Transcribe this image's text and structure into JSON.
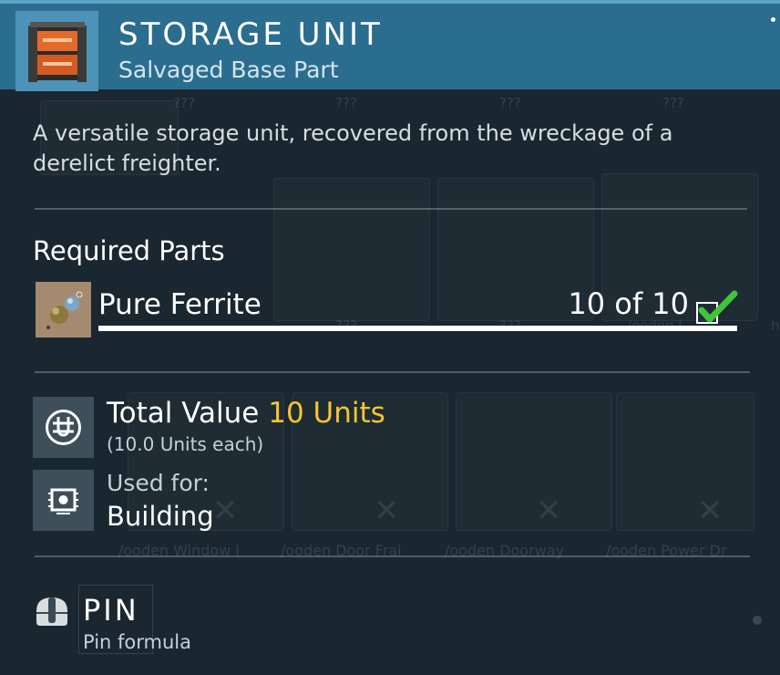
{
  "item": {
    "title": "STORAGE UNIT",
    "subtitle": "Salvaged Base Part",
    "icon": "storage-crate-icon",
    "description": "A versatile storage unit, recovered from the wreckage of a derelict freighter."
  },
  "required_parts": {
    "heading": "Required Parts",
    "items": [
      {
        "name": "Pure Ferrite",
        "count": "10 of 10",
        "icon": "pure-ferrite-icon",
        "complete": true,
        "progress": 1.0
      }
    ]
  },
  "value": {
    "label": "Total Value",
    "amount": "10 Units",
    "each": "(10.0 Units each)",
    "icon": "units-currency-icon"
  },
  "used_for": {
    "label": "Used for:",
    "value": "Building",
    "icon": "building-chip-icon"
  },
  "pin": {
    "label": "PIN",
    "sub": "Pin formula",
    "icon": "mouse-pin-icon"
  },
  "background": {
    "unknown_labels": [
      "???",
      "???",
      "???",
      "???",
      "???",
      "???"
    ],
    "item_labels": [
      "/ooden Window I",
      "/ooden Door Frai",
      "/ooden Doorway",
      "/ooden Power Dr"
    ],
    "partial_labels": [
      "/ooden l",
      "h"
    ]
  },
  "colors": {
    "header": "#2b6d8e",
    "accent_value": "#f7c531",
    "check": "#3fc43a",
    "background": "#1a2730"
  }
}
